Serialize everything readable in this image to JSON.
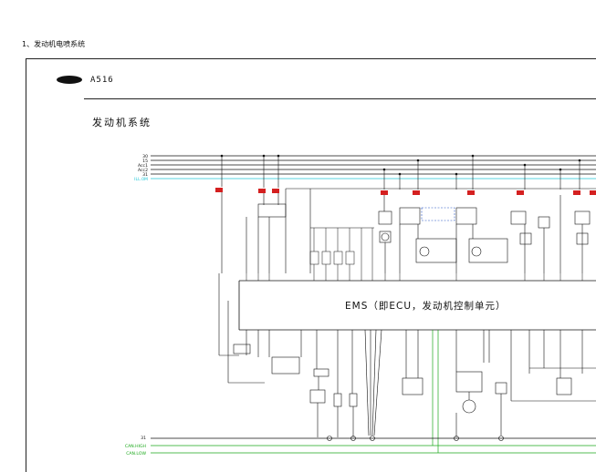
{
  "page": {
    "heading": "1、发动机电喷系统"
  },
  "sheet": {
    "model": "A516",
    "title": "发动机系统"
  },
  "buses_top": [
    "30",
    "15",
    "Acc1",
    "Acc2",
    "31",
    "ILL.0M"
  ],
  "buses_bottom": [
    "31",
    "CAN.HIGH",
    "CAN.LOW"
  ],
  "ecu": {
    "label": "EMS（即ECU，发动机控制单元）"
  },
  "colors": {
    "line": "#111111",
    "fuse_red": "#d42020",
    "can_green": "#1aa81a",
    "ill_cyan": "#22c8d8",
    "annotation_blue": "#2050c0"
  }
}
